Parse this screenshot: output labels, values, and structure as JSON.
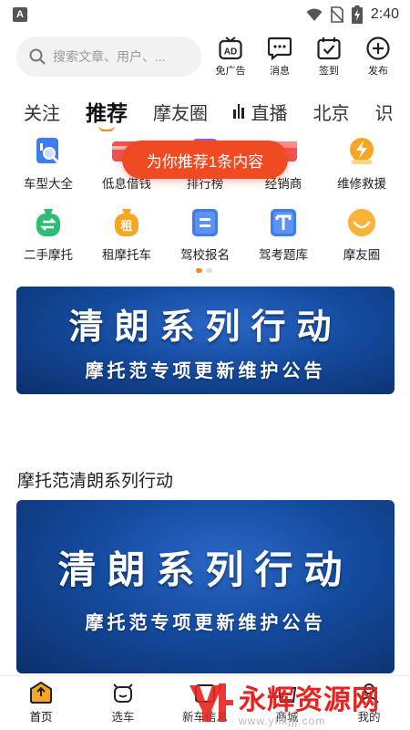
{
  "status": {
    "time": "2:40",
    "app_icon": "A"
  },
  "search": {
    "placeholder": "搜索文章、用户、..."
  },
  "header_actions": [
    {
      "label": "免广告",
      "icon": "ad-icon"
    },
    {
      "label": "消息",
      "icon": "message-icon"
    },
    {
      "label": "签到",
      "icon": "checkin-icon"
    },
    {
      "label": "发布",
      "icon": "plus-circle-icon"
    }
  ],
  "tabs": [
    "关注",
    "推荐",
    "摩友圈",
    "直播",
    "北京",
    "识"
  ],
  "active_tab": "推荐",
  "grid": [
    {
      "label": "车型大全",
      "icon": "car-model-icon",
      "color": "#3f7cf0"
    },
    {
      "label": "低息借钱",
      "icon": "loan-icon",
      "color": "#f25050"
    },
    {
      "label": "排行榜",
      "icon": "ranking-icon",
      "color": "#8a5cf0"
    },
    {
      "label": "经销商",
      "icon": "dealer-icon",
      "color": "#f25050"
    },
    {
      "label": "维修救援",
      "icon": "repair-icon",
      "color": "#f5a623"
    },
    {
      "label": "二手摩托",
      "icon": "used-moto-icon",
      "color": "#2dbd75"
    },
    {
      "label": "租摩托车",
      "icon": "rent-moto-icon",
      "color": "#f5a623",
      "glyph": "租"
    },
    {
      "label": "驾校报名",
      "icon": "driving-school-icon",
      "color": "#3f7cf0",
      "glyph": "="
    },
    {
      "label": "驾考题库",
      "icon": "exam-bank-icon",
      "color": "#3f7cf0",
      "glyph": "T"
    },
    {
      "label": "摩友圈",
      "icon": "moto-friends-icon",
      "color": "#f5a623"
    }
  ],
  "toast": "为你推荐1条内容",
  "banner": {
    "title": "清朗系列行动",
    "subtitle": "摩托范专项更新维护公告"
  },
  "article": {
    "title": "摩托范清朗系列行动"
  },
  "bottom_nav": [
    {
      "label": "首页",
      "icon": "home-icon"
    },
    {
      "label": "选车",
      "icon": "select-car-icon"
    },
    {
      "label": "新车信息",
      "icon": "new-car-icon"
    },
    {
      "label": "商城",
      "icon": "mall-icon"
    },
    {
      "label": "我的",
      "icon": "profile-icon"
    }
  ],
  "watermark": {
    "text": "永辉资源网",
    "url": "www.yhkjjj.com"
  },
  "colors": {
    "accent": "#f08a24",
    "toast": "#f04a23",
    "watermark": "#e8231f"
  }
}
